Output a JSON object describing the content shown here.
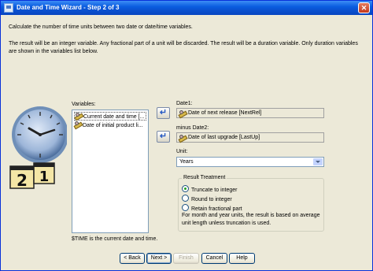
{
  "window": {
    "title": "Date and Time Wizard - Step 2 of 3",
    "close_glyph": "✕"
  },
  "intro": {
    "line1": "Calculate the number of time units between two date or date/time variables.",
    "line2": "The result will be an integer variable. Any fractional part of a unit will be discarded. The result will be a duration variable. Only duration variables are shown in the variables list below."
  },
  "variables": {
    "label": "Variables:",
    "items": [
      {
        "label": "Current date and time [...",
        "icon": "ruler-icon",
        "selected": true
      },
      {
        "label": "Date of initial product li...",
        "icon": "ruler-icon",
        "selected": false
      }
    ],
    "note": "$TIME is the current date and time."
  },
  "date1": {
    "label": "Date1:",
    "value": "Date of next release [NextRel]"
  },
  "date2": {
    "label": "minus Date2:",
    "value": "Date of last upgrade [LastUp]"
  },
  "move_glyph": "↵",
  "unit": {
    "label": "Unit:",
    "selected": "Years"
  },
  "result_treatment": {
    "title": "Result Treatment",
    "options": [
      "Truncate to integer",
      "Round to integer",
      "Retain fractional part"
    ],
    "selected_index": 0,
    "note": "For month and year units, the result is based on average unit length unless truncation is used."
  },
  "buttons": {
    "back": "< Back",
    "next": "Next >",
    "finish": "Finish",
    "cancel": "Cancel",
    "help": "Help"
  },
  "clock_image": {
    "icon": "clock-calendar-icon",
    "digits": [
      "2",
      "1"
    ]
  }
}
